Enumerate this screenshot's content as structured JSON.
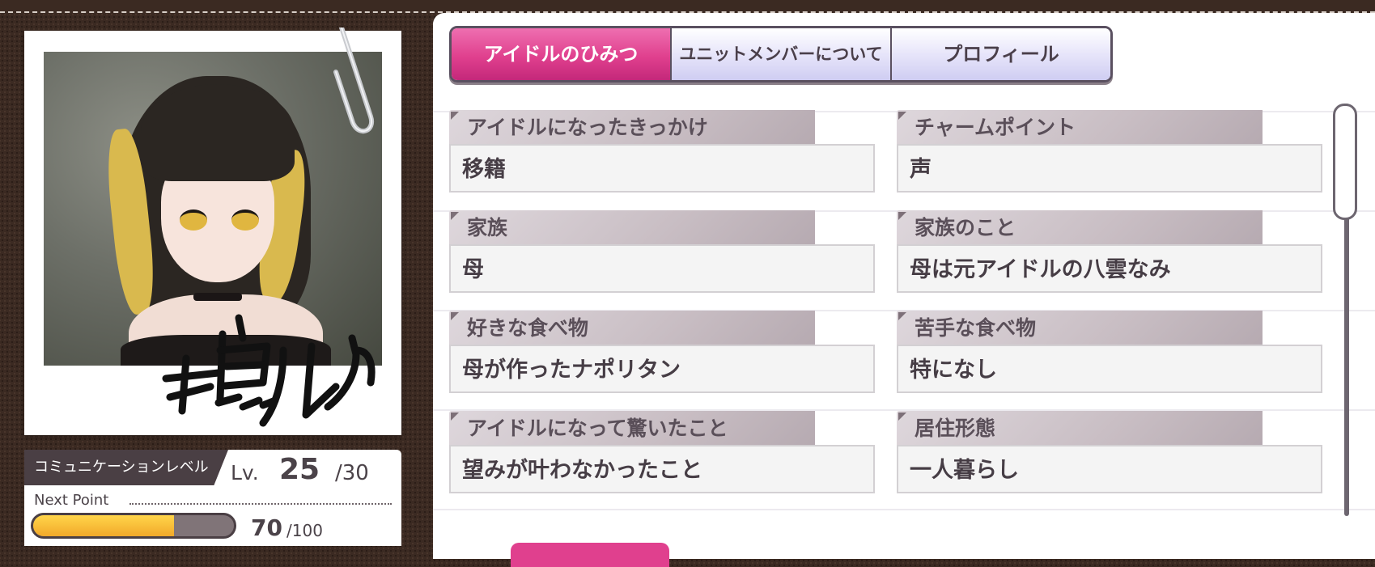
{
  "character": {
    "name_signature": "斑鳩ルカ"
  },
  "level": {
    "label": "コミュニケーションレベル",
    "lv_prefix": "Lv.",
    "current": "25",
    "max": "/30",
    "next_point_label": "Next Point",
    "points": "70",
    "points_max": "/100",
    "progress_fraction": 0.7
  },
  "tabs": [
    {
      "label": "アイドルのひみつ",
      "active": true
    },
    {
      "label": "ユニットメンバーについて",
      "active": false
    },
    {
      "label": "プロフィール",
      "active": false
    }
  ],
  "items": [
    {
      "label": "アイドルになったきっかけ",
      "value": "移籍"
    },
    {
      "label": "チャームポイント",
      "value": "声"
    },
    {
      "label": "家族",
      "value": "母"
    },
    {
      "label": "家族のこと",
      "value": "母は元アイドルの八雲なみ"
    },
    {
      "label": "好きな食べ物",
      "value": "母が作ったナポリタン"
    },
    {
      "label": "苦手な食べ物",
      "value": "特になし"
    },
    {
      "label": "アイドルになって驚いたこと",
      "value": "望みが叶わなかったこと"
    },
    {
      "label": "居住形態",
      "value": "一人暮らし"
    }
  ],
  "colors": {
    "accent_pink": "#e0408e",
    "progress_yellow": "#f2a92a",
    "frame_brown": "#3b2a22"
  }
}
